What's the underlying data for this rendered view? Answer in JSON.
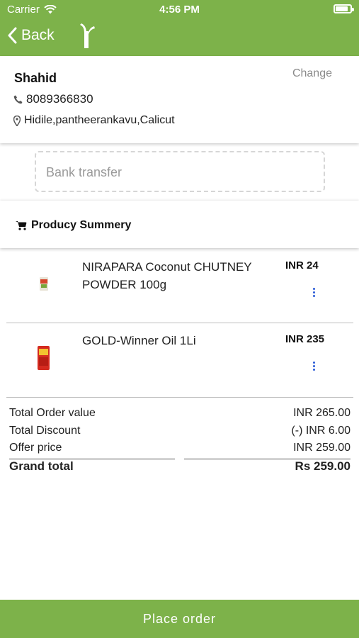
{
  "status_bar": {
    "carrier": "Carrier",
    "time": "4:56 PM"
  },
  "nav": {
    "back_label": "Back",
    "logo_icon": "brand-leaf-logo"
  },
  "address": {
    "name": "Shahid",
    "change_label": "Change",
    "phone": "8089366830",
    "location": "Hidile,pantheerankavu,Calicut"
  },
  "payment": {
    "method": "Bank transfer"
  },
  "summary": {
    "title": "Producy Summery"
  },
  "products": [
    {
      "name": "NIRAPARA Coconut CHUTNEY POWDER 100g",
      "price": "INR 24"
    },
    {
      "name": "GOLD-Winner Oil 1Li",
      "price": "INR 235"
    }
  ],
  "totals": {
    "order_value_label": "Total Order value",
    "order_value": "INR 265.00",
    "discount_label": "Total Discount",
    "discount": "(-) INR 6.00",
    "offer_label": "Offer price",
    "offer": "INR 259.00",
    "grand_label": "Grand total",
    "grand": "Rs 259.00"
  },
  "footer": {
    "place_order_label": "Place order"
  },
  "colors": {
    "accent": "#7db24a",
    "kebab": "#2a5bd7"
  }
}
